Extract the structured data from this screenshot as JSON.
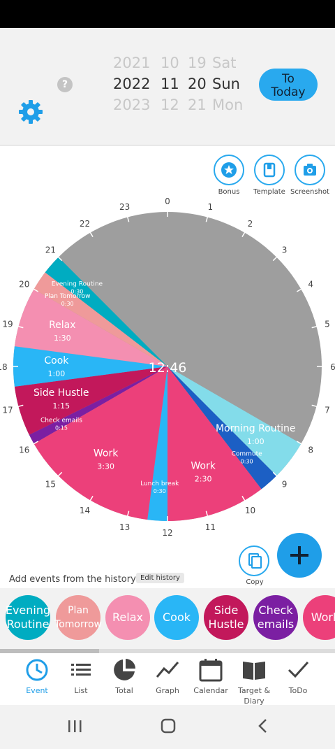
{
  "date_picker": {
    "prev": {
      "year": "2021",
      "month": "10",
      "day": "19",
      "weekday": "Sat"
    },
    "current": {
      "year": "2022",
      "month": "11",
      "day": "20",
      "weekday": "Sun"
    },
    "next": {
      "year": "2023",
      "month": "12",
      "day": "21",
      "weekday": "Mon"
    }
  },
  "help_label": "?",
  "to_today": {
    "line1": "To",
    "line2": "Today"
  },
  "tools": {
    "bonus": "Bonus",
    "template": "Template",
    "screenshot": "Screenshot"
  },
  "clock": {
    "center_time": "12:46",
    "hours": [
      "0",
      "1",
      "2",
      "3",
      "4",
      "5",
      "6",
      "7",
      "8",
      "9",
      "10",
      "11",
      "12",
      "13",
      "14",
      "15",
      "16",
      "17",
      "18",
      "19",
      "20",
      "21",
      "22",
      "23"
    ],
    "events": [
      {
        "name": "Morning Routine",
        "duration": "1:00",
        "start": 8,
        "end": 9,
        "color": "#83dcea"
      },
      {
        "name": "Commute",
        "duration": "0:30",
        "start": 9,
        "end": 9.5,
        "color": "#1c5fc4"
      },
      {
        "name": "Work",
        "duration": "2:30",
        "start": 9.5,
        "end": 12,
        "color": "#ec407a"
      },
      {
        "name": "Lunch break",
        "duration": "0:30",
        "start": 12,
        "end": 12.5,
        "color": "#29b6f6"
      },
      {
        "name": "Work",
        "duration": "3:30",
        "start": 12.5,
        "end": 16,
        "color": "#ec407a"
      },
      {
        "name": "Check emails",
        "duration": "0:15",
        "start": 16,
        "end": 16.25,
        "color": "#7b1fa2"
      },
      {
        "name": "Side Hustle",
        "duration": "1:15",
        "start": 16.25,
        "end": 17.5,
        "color": "#c2185b"
      },
      {
        "name": "Cook",
        "duration": "1:00",
        "start": 17.5,
        "end": 18.5,
        "color": "#29b6f6"
      },
      {
        "name": "Relax",
        "duration": "1:30",
        "start": 18.5,
        "end": 20,
        "color": "#f48fb1"
      },
      {
        "name": "Plan Tomorrow",
        "duration": "0:30",
        "start": 20,
        "end": 20.5,
        "color": "#ef9a9a"
      },
      {
        "name": "Evening Routine",
        "duration": "0:30",
        "start": 20.5,
        "end": 21,
        "color": "#00acc1"
      }
    ],
    "empty_color": "#9e9e9e"
  },
  "copy_label": "Copy",
  "history": {
    "label": "Add events from the history",
    "edit_label": "Edit history",
    "chips": [
      {
        "line1": "Evening",
        "line2": "Routine",
        "color": "#00acc1"
      },
      {
        "line1": "Plan",
        "line2": "Tomorrow",
        "color": "#ef9a9a"
      },
      {
        "line1": "Relax",
        "line2": "",
        "color": "#f48fb1"
      },
      {
        "line1": "Cook",
        "line2": "",
        "color": "#29b6f6"
      },
      {
        "line1": "Side",
        "line2": "Hustle",
        "color": "#c2185b"
      },
      {
        "line1": "Check",
        "line2": "emails",
        "color": "#7b1fa2"
      },
      {
        "line1": "Work",
        "line2": "",
        "color": "#ec407a"
      }
    ]
  },
  "nav": [
    {
      "label": "Event",
      "icon": "clock-icon",
      "active": true
    },
    {
      "label": "List",
      "icon": "list-icon"
    },
    {
      "label": "Total",
      "icon": "pie-chart-icon"
    },
    {
      "label": "Graph",
      "icon": "line-graph-icon"
    },
    {
      "label": "Calendar",
      "icon": "calendar-icon"
    },
    {
      "label": "Target & Diary",
      "icon": "book-icon"
    },
    {
      "label": "ToDo",
      "icon": "check-icon"
    }
  ],
  "colors": {
    "accent": "#29a9ee"
  }
}
